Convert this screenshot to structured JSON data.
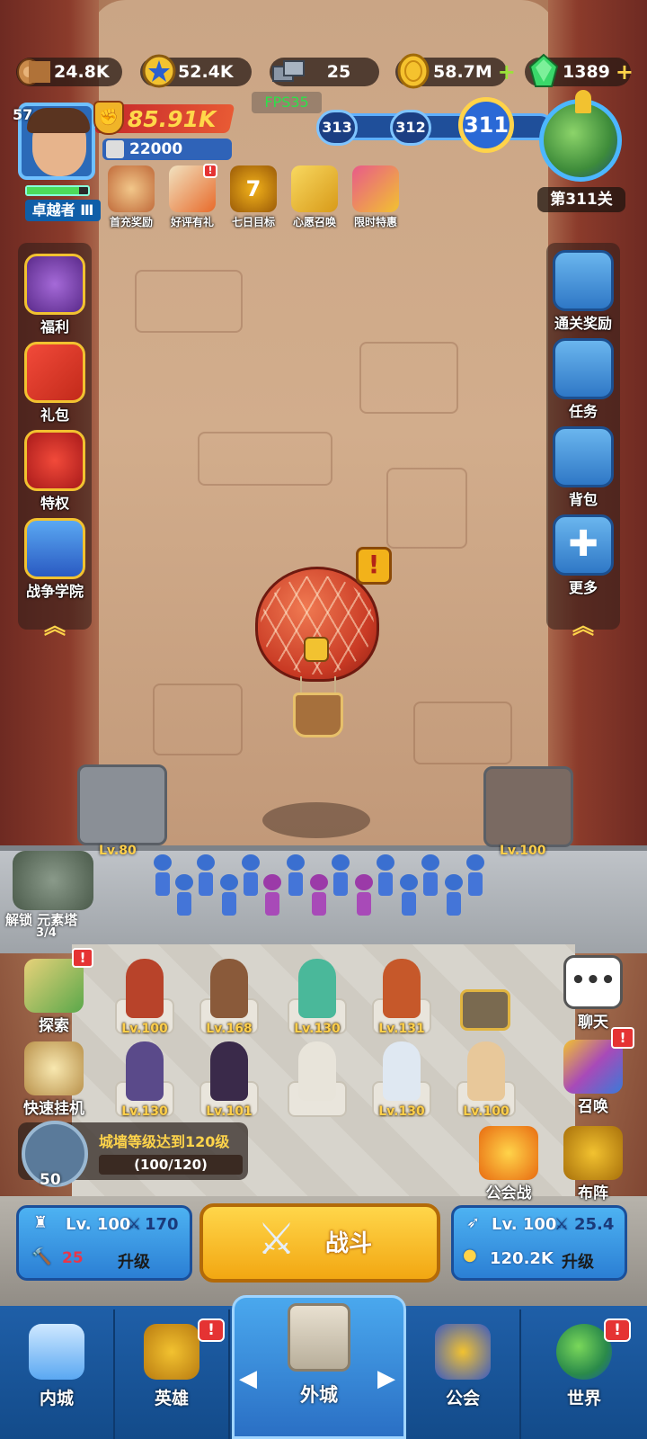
{
  "resources": [
    {
      "name": "wood",
      "value": "24.8K",
      "icon": "log-icon"
    },
    {
      "name": "honor",
      "value": "52.4K",
      "icon": "star-medal-icon"
    },
    {
      "name": "iron",
      "value": "25",
      "icon": "iron-ingot-icon"
    },
    {
      "name": "gold",
      "value": "58.7M",
      "icon": "gold-coin-icon"
    },
    {
      "name": "gems",
      "value": "1389",
      "icon": "green-gem-icon"
    }
  ],
  "fps": "FPS35",
  "player": {
    "level": "57",
    "rank": "卓越者 Ⅲ",
    "power": "85.91K",
    "sub_power": "22000"
  },
  "events": [
    {
      "label": "首充奖励",
      "color": "#f2c78a",
      "badge": false
    },
    {
      "label": "好评有礼",
      "color": "#f1e2c0",
      "badge": true
    },
    {
      "label": "七日目标",
      "color": "#f2b21a",
      "badge": false
    },
    {
      "label": "心愿召唤",
      "color": "#f2c230",
      "badge": false
    },
    {
      "label": "限时特惠",
      "color": "#e85a8a",
      "badge": false
    }
  ],
  "stage": {
    "prev2": "313",
    "prev1": "312",
    "current": "311",
    "label": "第311关"
  },
  "left_menu": [
    {
      "label": "福利",
      "color": "#7a3aa8"
    },
    {
      "label": "礼包",
      "color": "#e23a2a"
    },
    {
      "label": "特权",
      "color": "#d82a2a"
    },
    {
      "label": "战争学院",
      "color": "#3a7ad8"
    }
  ],
  "right_menu": [
    {
      "label": "通关奖励"
    },
    {
      "label": "任务"
    },
    {
      "label": "背包"
    },
    {
      "label": "更多"
    }
  ],
  "towers": {
    "left_level": "Lv.80",
    "right_level": "Lv.100"
  },
  "unlock": {
    "label": "解锁 元素塔",
    "count": "3/4"
  },
  "heroes": [
    {
      "level": "Lv.100",
      "color": "#b8432a"
    },
    {
      "level": "Lv.168",
      "color": "#8a5a3a"
    },
    {
      "level": "Lv.130",
      "color": "#4ab89a"
    },
    {
      "level": "Lv.131",
      "color": "#c6582a"
    },
    {
      "level": "Lv.130",
      "color": "#5a4a8a"
    },
    {
      "level": "Lv.101",
      "color": "#3a2a4a"
    },
    {
      "level": "",
      "color": "#e8e4da"
    },
    {
      "level": "Lv.130",
      "color": "#dfe8f2"
    },
    {
      "level": "Lv.100",
      "color": "#e8c89a"
    }
  ],
  "left_buttons": [
    {
      "label": "探索"
    },
    {
      "label": "快速挂机"
    }
  ],
  "right_buttons": [
    {
      "label": "聊天"
    },
    {
      "label": "召唤"
    },
    {
      "label": "布阵"
    }
  ],
  "guild_war": "公会战",
  "wall_task": {
    "title": "城墙等级达到120级",
    "progress": "(100/120)",
    "wheel_count": "50"
  },
  "wall_upgrade": {
    "level": "Lv. 100",
    "attack": "170",
    "cost": "25",
    "action": "升级"
  },
  "fight": {
    "label": "战斗"
  },
  "archer_upgrade": {
    "level": "Lv. 100",
    "attack": "25.4",
    "cost": "120.2K",
    "action": "升级"
  },
  "nav": [
    {
      "label": "内城",
      "badge": ""
    },
    {
      "label": "英雄",
      "badge": "!"
    },
    {
      "label": "外城",
      "badge": ""
    },
    {
      "label": "公会",
      "badge": ""
    },
    {
      "label": "世界",
      "badge": "!"
    }
  ],
  "colors": {
    "accent_gold": "#ffd44a",
    "panel_blue": "#2b7fd4",
    "badge_red": "#e53333",
    "fps_green": "#2ee04a"
  }
}
